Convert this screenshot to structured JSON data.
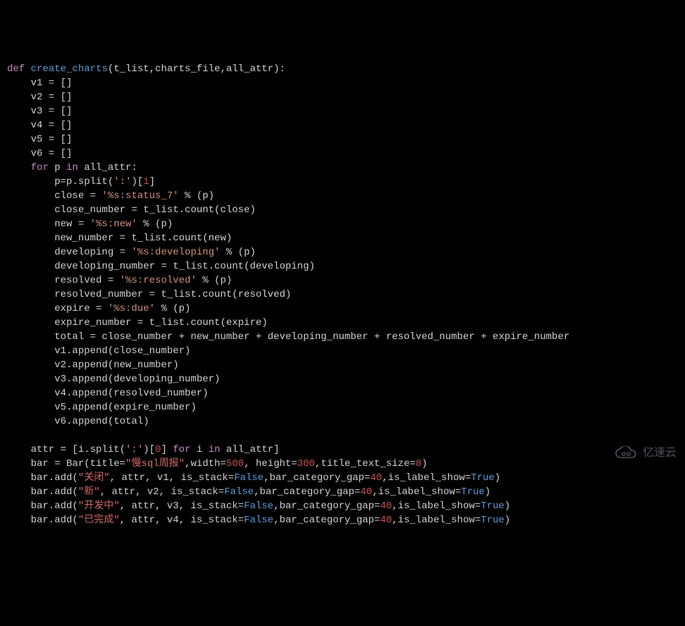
{
  "code": {
    "l01_def": "def",
    "l01_fn": "create_charts",
    "l01_rest": "(t_list,charts_file,all_attr):",
    "l02": "    v1 = []",
    "l03": "    v2 = []",
    "l04": "    v3 = []",
    "l05": "    v4 = []",
    "l06": "    v5 = []",
    "l07": "    v6 = []",
    "l08_for": "    for",
    "l08_p": " p ",
    "l08_in": "in",
    "l08_rest": " all_attr:",
    "l09a": "        p=p.split(",
    "l09s": "':'",
    "l09b": ")[",
    "l09n": "1",
    "l09c": "]",
    "l10a": "        close = ",
    "l10s": "'%s:status_7'",
    "l10b": " % (p)",
    "l11": "        close_number = t_list.count(close)",
    "l12a": "        new = ",
    "l12s": "'%s:new'",
    "l12b": " % (p)",
    "l13": "        new_number = t_list.count(new)",
    "l14a": "        developing = ",
    "l14s": "'%s:developing'",
    "l14b": " % (p)",
    "l15": "        developing_number = t_list.count(developing)",
    "l16a": "        resolved = ",
    "l16s": "'%s:resolved'",
    "l16b": " % (p)",
    "l17": "        resolved_number = t_list.count(resolved)",
    "l18a": "        expire = ",
    "l18s": "'%s:due'",
    "l18b": " % (p)",
    "l19": "        expire_number = t_list.count(expire)",
    "l20": "        total = close_number + new_number + developing_number + resolved_number + expire_number",
    "l21": "        v1.append(close_number)",
    "l22": "        v2.append(new_number)",
    "l23": "        v3.append(developing_number)",
    "l24": "        v4.append(resolved_number)",
    "l25": "        v5.append(expire_number)",
    "l26": "        v6.append(total)",
    "l27": "",
    "l28a": "    attr = [i.split(",
    "l28s": "':'",
    "l28b": ")[",
    "l28n": "0",
    "l28c": "] ",
    "l28for": "for",
    "l28i": " i ",
    "l28in": "in",
    "l28d": " all_attr]",
    "l29a": "    bar = Bar(title=",
    "l29s": "\"慢sql周报\"",
    "l29b": ",width=",
    "l29n1": "500",
    "l29c": ", height=",
    "l29n2": "300",
    "l29d": ",title_text_size=",
    "l29n3": "8",
    "l29e": ")",
    "l30a": "    bar.add(",
    "l30s": "\"关闭\"",
    "l30b": ", attr, v1, is_stack=",
    "l30f": "False",
    "l30c": ",bar_category_gap=",
    "l30n": "40",
    "l30d": ",is_label_show=",
    "l30t": "True",
    "l30e": ")",
    "l31a": "    bar.add(",
    "l31s": "\"新\"",
    "l31b": ", attr, v2, is_stack=",
    "l31f": "False",
    "l31c": ",bar_category_gap=",
    "l31n": "40",
    "l31d": ",is_label_show=",
    "l31t": "True",
    "l31e": ")",
    "l32a": "    bar.add(",
    "l32s": "\"开发中\"",
    "l32b": ", attr, v3, is_stack=",
    "l32f": "False",
    "l32c": ",bar_category_gap=",
    "l32n": "40",
    "l32d": ",is_label_show=",
    "l32t": "True",
    "l32e": ")",
    "l33a": "    bar.add(",
    "l33s": "\"已完成\"",
    "l33b": ", attr, v4, is_stack=",
    "l33f": "False",
    "l33c": ",bar_category_gap=",
    "l33n": "40",
    "l33d": ",is_label_show=",
    "l33t": "True",
    "l33e": ")"
  },
  "watermark": {
    "text": "亿速云"
  }
}
